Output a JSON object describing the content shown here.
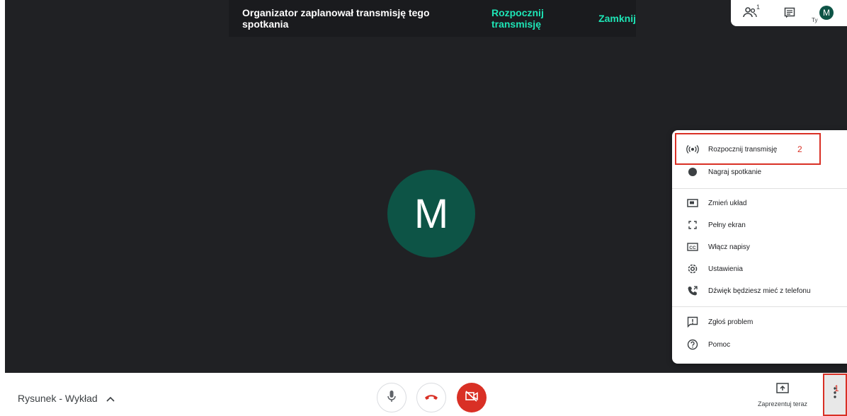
{
  "banner": {
    "message": "Organizator zaplanował transmisję tego spotkania",
    "start_label": "Rozpocznij transmisję",
    "close_label": "Zamknij"
  },
  "topbar": {
    "people_icon": "people-icon",
    "people_count": "1",
    "chat_icon": "chat-icon",
    "you_label": "Ty",
    "avatar_letter": "M"
  },
  "participant": {
    "avatar_letter": "M",
    "avatar_color": "#0d5446"
  },
  "menu": {
    "items": [
      {
        "label": "Rozpocznij transmisję",
        "icon": "broadcast-icon"
      },
      {
        "label": "Nagraj spotkanie",
        "icon": "record-icon"
      },
      {
        "label": "Zmień układ",
        "icon": "layout-icon"
      },
      {
        "label": "Pełny ekran",
        "icon": "fullscreen-icon"
      },
      {
        "label": "Włącz napisy",
        "icon": "captions-icon"
      },
      {
        "label": "Ustawienia",
        "icon": "settings-icon"
      },
      {
        "label": "Dźwięk będziesz mieć z telefonu",
        "icon": "phone-audio-icon"
      },
      {
        "label": "Zgłoś problem",
        "icon": "report-problem-icon"
      },
      {
        "label": "Pomoc",
        "icon": "help-icon"
      }
    ]
  },
  "annotations": {
    "first": "1",
    "second": "2",
    "color": "#d93025"
  },
  "bottom": {
    "meeting_title": "Rysunek - Wykład",
    "present_label": "Zaprezentuj teraz",
    "end_call_color": "#d93025",
    "accent": "#1ee5b6"
  }
}
